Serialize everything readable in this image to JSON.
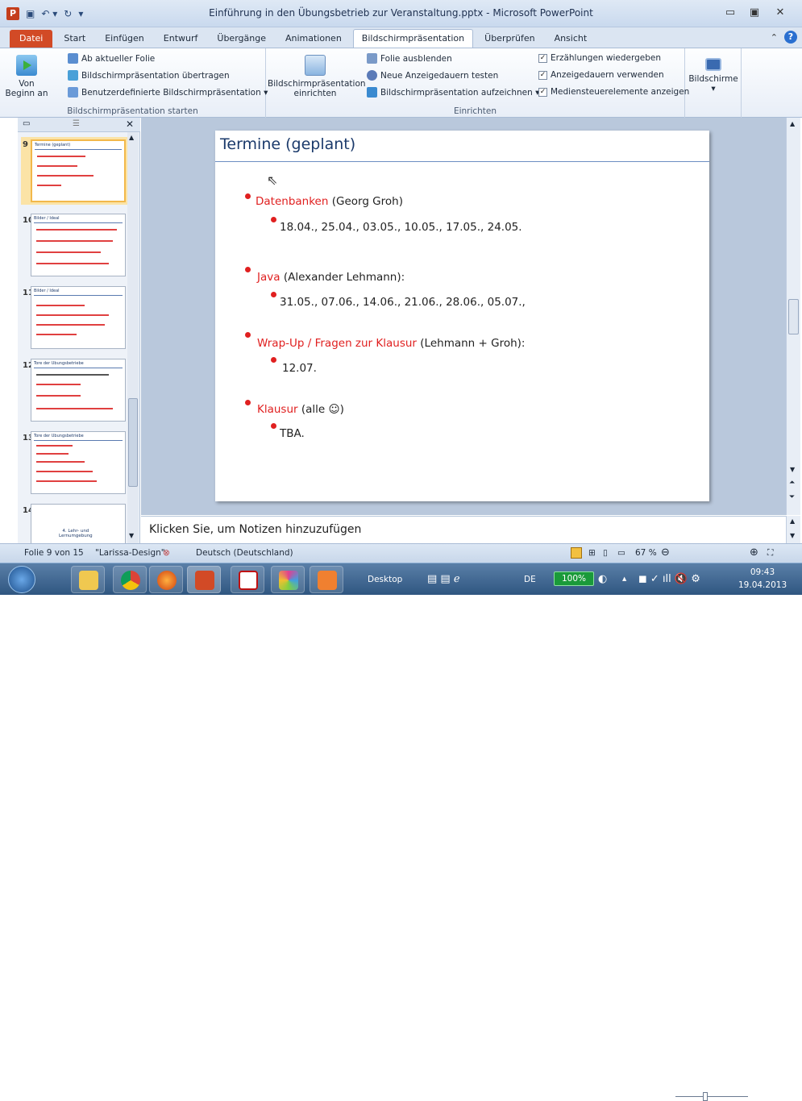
{
  "window": {
    "title": "Einführung in den Übungsbetrieb zur Veranstaltung.pptx - Microsoft PowerPoint"
  },
  "tabs": [
    "Datei",
    "Start",
    "Einfügen",
    "Entwurf",
    "Übergänge",
    "Animationen",
    "Bildschirmpräsentation",
    "Überprüfen",
    "Ansicht"
  ],
  "active_tab": "Bildschirmpräsentation",
  "ribbon": {
    "group1": {
      "label": "Bildschirmpräsentation starten",
      "from_start_1": "Von",
      "from_start_2": "Beginn an",
      "from_current": "Ab aktueller Folie",
      "broadcast": "Bildschirmpräsentation übertragen",
      "custom": "Benutzerdefinierte Bildschirmpräsentation ▾"
    },
    "group2": {
      "label": "Einrichten",
      "setup_1": "Bildschirmpräsentation",
      "setup_2": "einrichten",
      "hide_slide": "Folie ausblenden",
      "rehearse": "Neue Anzeigedauern testen",
      "record": "Bildschirmpräsentation aufzeichnen ▾",
      "play_narrations": "Erzählungen wiedergeben",
      "use_timings": "Anzeigedauern verwenden",
      "show_media": "Mediensteuerelemente anzeigen",
      "check_mark": "✓"
    },
    "group3": {
      "monitors": "Bildschirme",
      "arrow": "▾"
    }
  },
  "thumbnails": [
    {
      "num": "9",
      "title": "Termine (geplant)",
      "selected": true
    },
    {
      "num": "10",
      "title": "Bilder / Ideal"
    },
    {
      "num": "11",
      "title": "Bilder / Ideal"
    },
    {
      "num": "12",
      "title": "Tore der Ubungsbetriebe"
    },
    {
      "num": "13",
      "title": "Tore der Ubungsbetriebe"
    },
    {
      "num": "14",
      "title": "",
      "text1": "4. Lehr- und",
      "text2": "Lernumgebung"
    }
  ],
  "slide": {
    "title": "Termine (geplant)",
    "items": [
      {
        "red": "Datenbanken",
        "rest": " (Georg Groh)",
        "sub": "18.04., 25.04., 03.05., 10.05., 17.05., 24.05."
      },
      {
        "red": "Java",
        "rest": " (Alexander Lehmann):",
        "sub": "31.05., 07.06., 14.06., 21.06., 28.06., 05.07.,"
      },
      {
        "red": "Wrap-Up / Fragen zur Klausur",
        "rest": " (Lehmann + Groh):",
        "sub": "12.07."
      },
      {
        "red": "Klausur",
        "rest": " (alle ☺)",
        "sub": "TBA."
      }
    ]
  },
  "notes": {
    "placeholder": "Klicken Sie, um Notizen hinzuzufügen"
  },
  "status": {
    "slide_info": "Folie 9 von 15",
    "theme": "\"Larissa-Design\"",
    "language": "Deutsch (Deutschland)",
    "zoom": "67 %"
  },
  "taskbar": {
    "desktop": "Desktop",
    "lang": "DE",
    "battery": "100%",
    "time": "09:43",
    "date": "19.04.2013"
  },
  "colors": {
    "accent_red": "#e02020",
    "file_tab": "#d24a26",
    "title_blue": "#1b3a6b"
  }
}
